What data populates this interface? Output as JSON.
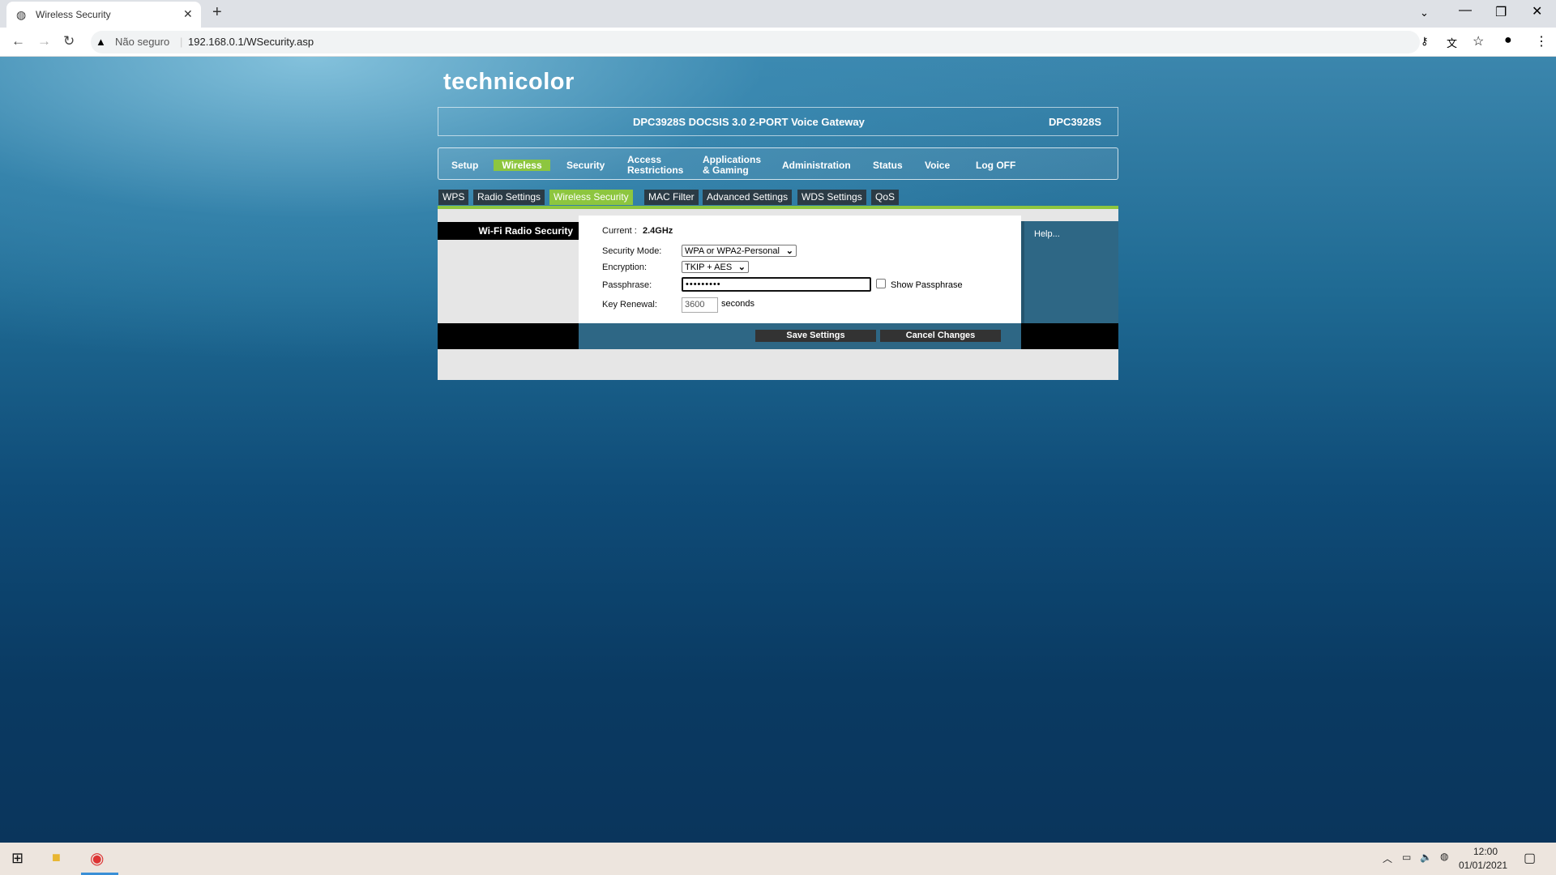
{
  "browser": {
    "tab_title": "Wireless Security",
    "security_label": "Não seguro",
    "url": "192.168.0.1/WSecurity.asp"
  },
  "brand": {
    "logo": "technicolor",
    "title": "DPC3928S DOCSIS 3.0 2-PORT Voice Gateway",
    "model": "DPC3928S"
  },
  "nav": [
    {
      "label": "Setup"
    },
    {
      "label": "Wireless",
      "active": true
    },
    {
      "label": "Security"
    },
    {
      "label": "Access Restrictions"
    },
    {
      "label": "Applications & Gaming"
    },
    {
      "label": "Administration"
    },
    {
      "label": "Status"
    },
    {
      "label": "Voice"
    },
    {
      "label": "Log OFF"
    }
  ],
  "subtabs": [
    {
      "label": "WPS"
    },
    {
      "label": "Radio Settings"
    },
    {
      "label": "Wireless Security",
      "active": true
    },
    {
      "label": "MAC Filter"
    },
    {
      "label": "Advanced Settings"
    },
    {
      "label": "WDS Settings"
    },
    {
      "label": "QoS"
    }
  ],
  "section_label": "Wi-Fi Radio Security",
  "form": {
    "current_label": "Current :",
    "current_value": "2.4GHz",
    "security_mode_label": "Security Mode:",
    "security_mode_value": "WPA or WPA2-Personal",
    "encryption_label": "Encryption:",
    "encryption_value": "TKIP + AES",
    "passphrase_label": "Passphrase:",
    "passphrase_value": "•••••••••",
    "show_passphrase_label": "Show Passphrase",
    "show_passphrase_checked": false,
    "key_renewal_label": "Key Renewal:",
    "key_renewal_value": "3600",
    "key_renewal_unit": "seconds"
  },
  "help_label": "Help...",
  "buttons": {
    "save": "Save Settings",
    "cancel": "Cancel Changes"
  },
  "taskbar": {
    "time": "12:00",
    "date": "01/01/2021"
  },
  "colors": {
    "accent": "#8dc63f",
    "panel": "#2e6785"
  }
}
